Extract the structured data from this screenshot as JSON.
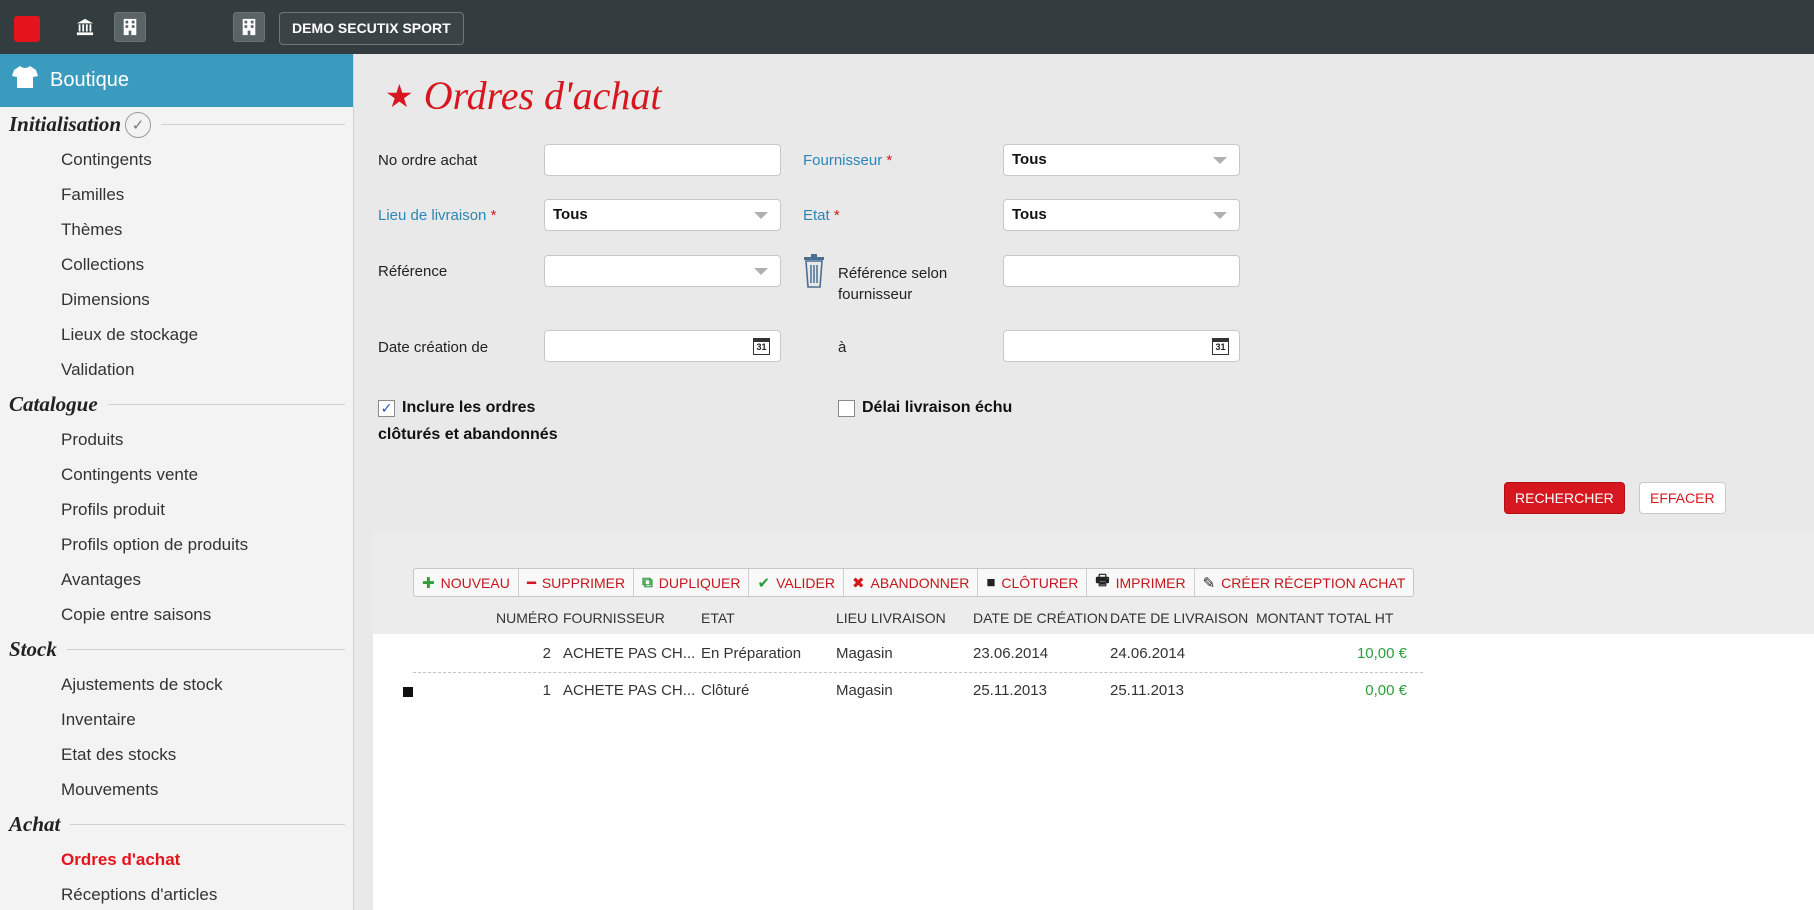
{
  "topbar": {
    "brand_icon": "secutix-logo-icon",
    "icons": [
      "bank-icon",
      "building-icon",
      "building-icon"
    ],
    "org_button": "DEMO SECUTIX SPORT"
  },
  "sidebar": {
    "header": "Boutique",
    "header_icon": "tshirt-icon",
    "sections": [
      {
        "title": "Initialisation",
        "items": [
          "Contingents",
          "Familles",
          "Thèmes",
          "Collections",
          "Dimensions",
          "Lieux de stockage",
          "Validation"
        ]
      },
      {
        "title": "Catalogue",
        "items": [
          "Produits",
          "Contingents vente",
          "Profils produit",
          "Profils option de produits",
          "Avantages",
          "Copie entre saisons"
        ]
      },
      {
        "title": "Stock",
        "items": [
          "Ajustements de stock",
          "Inventaire",
          "Etat des stocks",
          "Mouvements"
        ]
      },
      {
        "title": "Achat",
        "items": [
          "Ordres d'achat",
          "Réceptions d'articles"
        ]
      }
    ],
    "active_item": "Ordres d'achat"
  },
  "page": {
    "title": "Ordres d'achat"
  },
  "form": {
    "order_number_label": "No ordre achat",
    "supplier_label": "Fournisseur",
    "supplier_value": "Tous",
    "delivery_place_label": "Lieu de livraison",
    "delivery_place_value": "Tous",
    "state_label": "Etat",
    "state_value": "Tous",
    "reference_label": "Référence",
    "supplier_reference_label_1": "Référence selon",
    "supplier_reference_label_2": "fournisseur",
    "date_from_label": "Date création de",
    "date_to_label": "à",
    "required_mark": "*",
    "calendar_text": "31",
    "include_closed_label_1": "Inclure les ordres",
    "include_closed_label_2": "clôturés et abandonnés",
    "include_closed_checked": true,
    "delivery_overdue_label": "Délai livraison échu",
    "delivery_overdue_checked": false,
    "search_button": "RECHERCHER",
    "clear_button": "EFFACER"
  },
  "toolbar": {
    "new": "NOUVEAU",
    "delete": "SUPPRIMER",
    "duplicate": "DUPLIQUER",
    "validate": "VALIDER",
    "abandon": "ABANDONNER",
    "close": "CLÔTURER",
    "print": "IMPRIMER",
    "create_receipt": "CRÉER RÉCEPTION ACHAT"
  },
  "table": {
    "columns": [
      "NUMÉRO",
      "FOURNISSEUR",
      "ETAT",
      "LIEU LIVRAISON",
      "DATE DE CRÉATION",
      "DATE DE LIVRAISON",
      "MONTANT TOTAL HT"
    ],
    "rows": [
      {
        "marker": false,
        "number": "2",
        "supplier": "ACHETE PAS CH...",
        "state": "En Préparation",
        "place": "Magasin",
        "created": "23.06.2014",
        "delivery": "24.06.2014",
        "amount": "10,00 €"
      },
      {
        "marker": true,
        "number": "1",
        "supplier": "ACHETE PAS CH...",
        "state": "Clôturé",
        "place": "Magasin",
        "created": "25.11.2013",
        "delivery": "25.11.2013",
        "amount": "0,00 €"
      }
    ]
  }
}
